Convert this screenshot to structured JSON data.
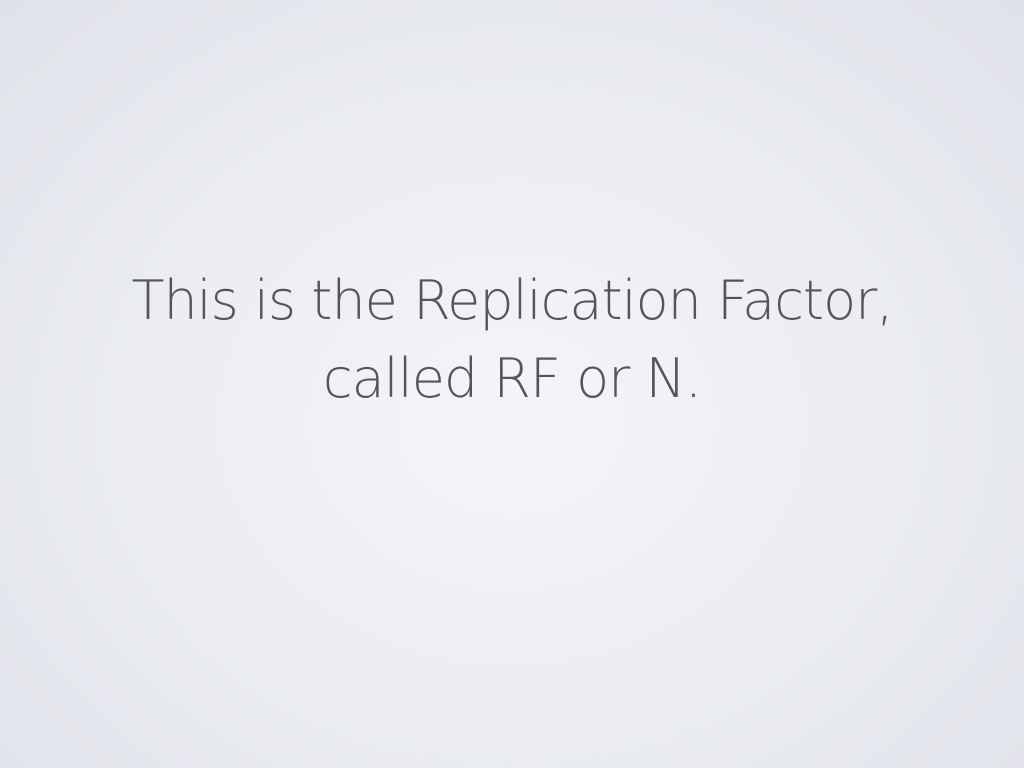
{
  "slide": {
    "line1": "This is the Replication Factor,",
    "line2": "called RF or N."
  }
}
